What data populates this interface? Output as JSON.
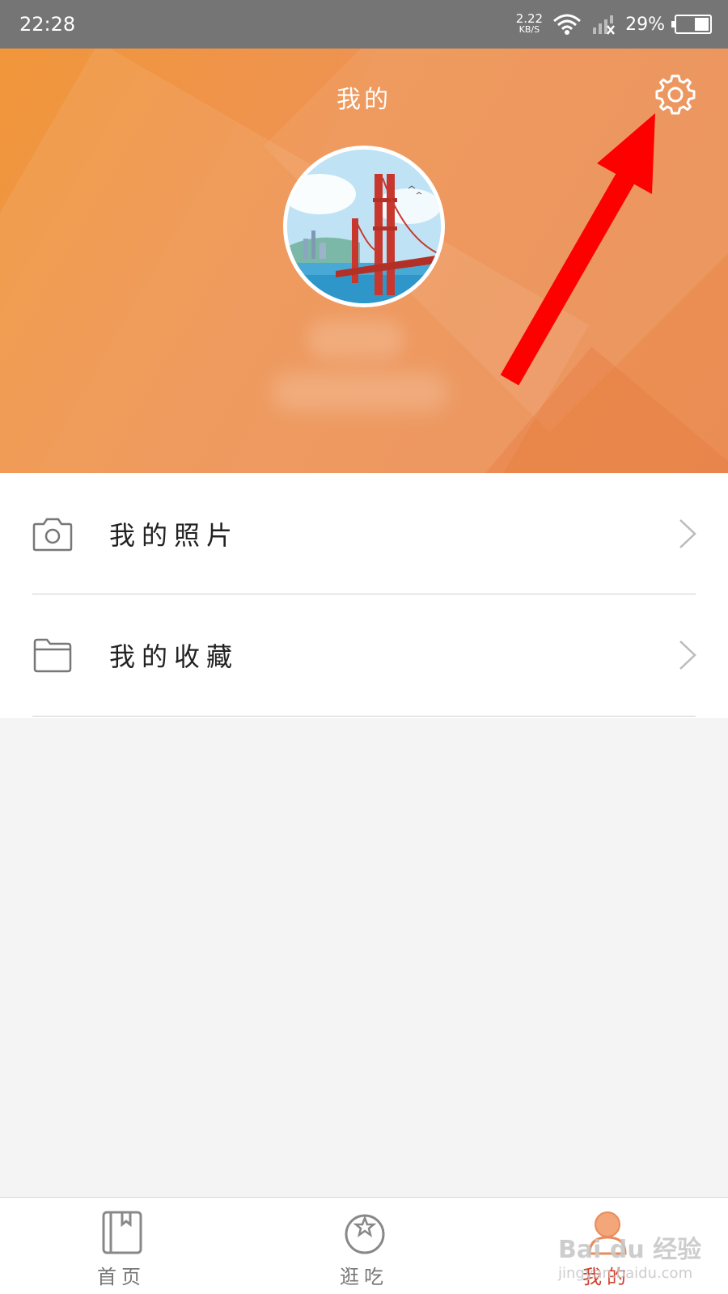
{
  "status_bar": {
    "time": "22:28",
    "net_speed_value": "2.22",
    "net_speed_unit": "KB/S",
    "battery_percent": "29%",
    "battery_level": 0.29
  },
  "header": {
    "title": "我的",
    "settings_icon": "gear-icon",
    "avatar_icon": "golden-gate-bridge-avatar"
  },
  "menu": {
    "items": [
      {
        "label": "我的照片",
        "icon": "camera-icon"
      },
      {
        "label": "我的收藏",
        "icon": "folder-icon"
      }
    ]
  },
  "bottom_nav": {
    "items": [
      {
        "label": "首页",
        "icon": "book-icon",
        "active": false
      },
      {
        "label": "逛吃",
        "icon": "fruit-star-icon",
        "active": false
      },
      {
        "label": "我的",
        "icon": "user-icon",
        "active": true
      }
    ]
  },
  "watermark": {
    "brand": "Bai du 经验",
    "url": "jingyan.baidu.com"
  },
  "colors": {
    "header_orange": "#ee9352",
    "active_red": "#d0402e",
    "arrow_red": "#ff0000"
  }
}
